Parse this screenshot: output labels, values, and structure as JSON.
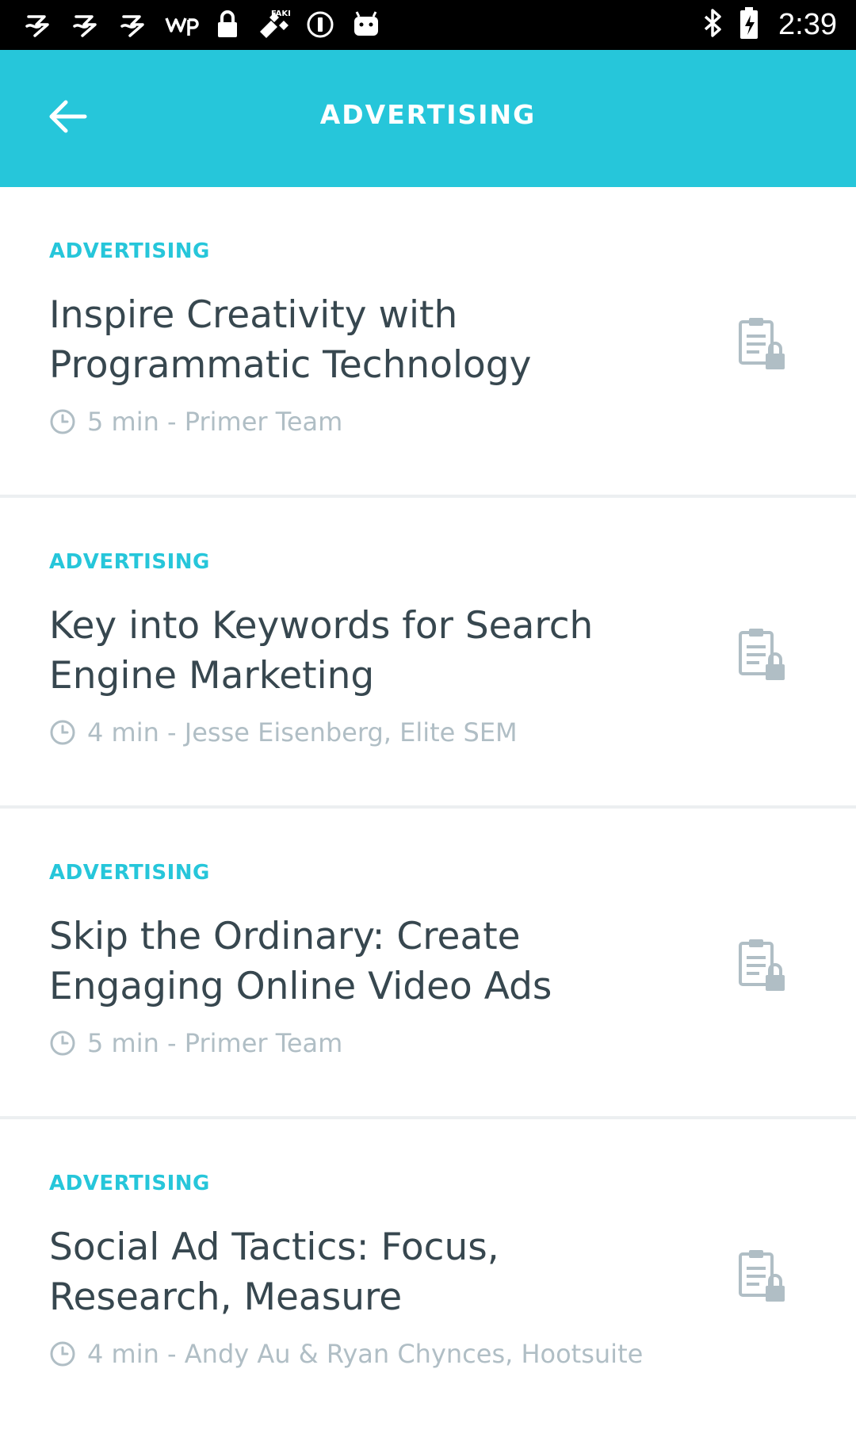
{
  "status_bar": {
    "time": "2:39",
    "icons": [
      "app-notification-icon",
      "app-notification-icon",
      "app-notification-icon",
      "washington-post-icon",
      "lock-icon",
      "fake-gps-icon",
      "info-circle-icon",
      "android-icon",
      "bluetooth-icon",
      "battery-icon"
    ]
  },
  "app_bar": {
    "title": "ADVERTISING",
    "back_icon": "arrow-back-icon"
  },
  "colors": {
    "accent": "#26c6da",
    "title_text": "#37474f",
    "meta_text": "#b0bec5",
    "divider": "#eceff1"
  },
  "lessons": [
    {
      "category": "ADVERTISING",
      "title": "Inspire Creativity with Programmatic Technology",
      "meta": "5 min - Primer Team",
      "status_icon": "locked-lesson-icon"
    },
    {
      "category": "ADVERTISING",
      "title": "Key into Keywords for Search Engine Marketing",
      "meta": "4 min - Jesse Eisenberg, Elite SEM",
      "status_icon": "locked-lesson-icon"
    },
    {
      "category": "ADVERTISING",
      "title": "Skip the Ordinary: Create Engaging Online Video Ads",
      "meta": "5 min - Primer Team",
      "status_icon": "locked-lesson-icon"
    },
    {
      "category": "ADVERTISING",
      "title": "Social Ad Tactics: Focus, Research, Measure",
      "meta": "4 min - Andy Au & Ryan Chynces, Hootsuite",
      "status_icon": "locked-lesson-icon"
    }
  ]
}
